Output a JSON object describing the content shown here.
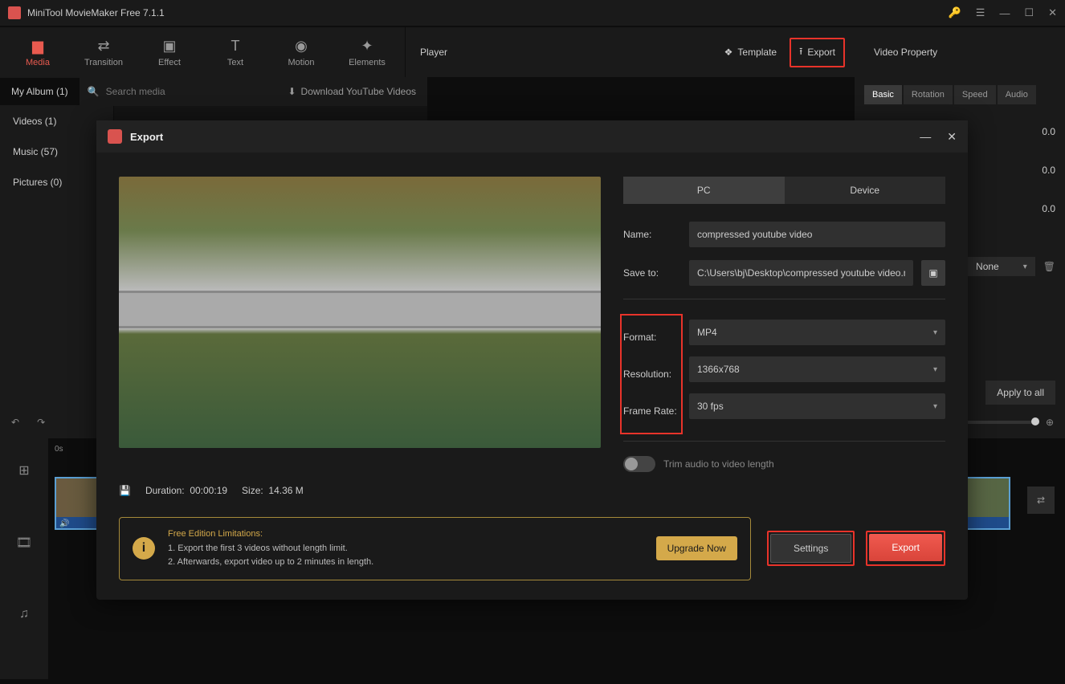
{
  "titlebar": {
    "title": "MiniTool MovieMaker Free 7.1.1"
  },
  "toolbar": {
    "media": "Media",
    "transition": "Transition",
    "effect": "Effect",
    "text": "Text",
    "motion": "Motion",
    "elements": "Elements",
    "player": "Player",
    "template": "Template",
    "export": "Export",
    "video_property": "Video Property"
  },
  "album": {
    "tab": "My Album (1)",
    "search_placeholder": "Search media",
    "download": "Download YouTube Videos",
    "items": {
      "videos": "Videos (1)",
      "music": "Music (57)",
      "pictures": "Pictures (0)"
    }
  },
  "props": {
    "tabs": {
      "basic": "Basic",
      "rotation": "Rotation",
      "speed": "Speed",
      "audio": "Audio"
    },
    "v0": "0.0",
    "v1": "0.0",
    "v2": "0.0",
    "none": "None",
    "apply_all": "Apply to all"
  },
  "timeline": {
    "zero": "0s"
  },
  "modal": {
    "title": "Export",
    "tabs": {
      "pc": "PC",
      "device": "Device"
    },
    "name_label": "Name:",
    "name_value": "compressed youtube video",
    "saveto_label": "Save to:",
    "saveto_value": "C:\\Users\\bj\\Desktop\\compressed youtube video.m",
    "format_label": "Format:",
    "format_value": "MP4",
    "resolution_label": "Resolution:",
    "resolution_value": "1366x768",
    "framerate_label": "Frame Rate:",
    "framerate_value": "30 fps",
    "trim_label": "Trim audio to video length",
    "duration_label": "Duration:",
    "duration_value": "00:00:19",
    "size_label": "Size:",
    "size_value": "14.36 M",
    "limitations": {
      "title": "Free Edition Limitations:",
      "line1": "1. Export the first 3 videos without length limit.",
      "line2": "2. Afterwards, export video up to 2 minutes in length.",
      "upgrade": "Upgrade Now"
    },
    "settings_btn": "Settings",
    "export_btn": "Export"
  }
}
